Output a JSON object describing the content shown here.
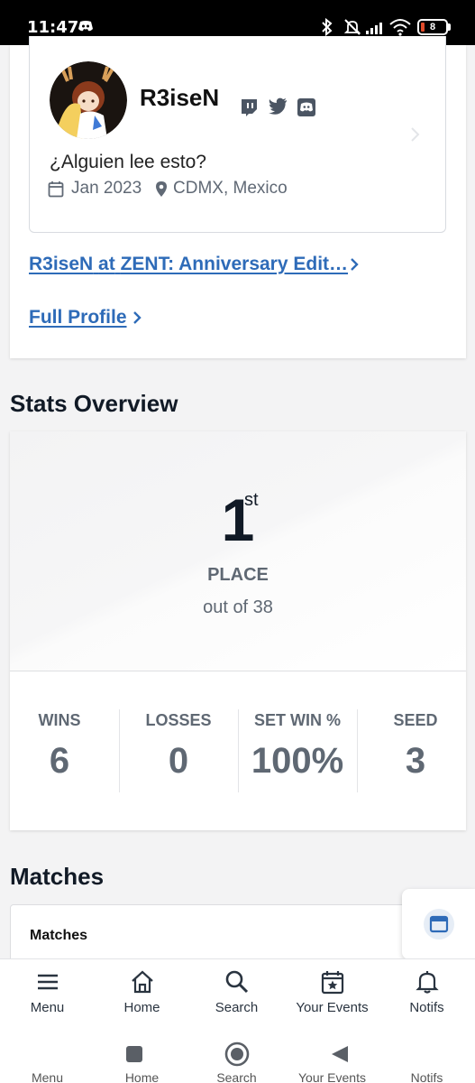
{
  "status_bar": {
    "time": "11:47",
    "battery": "8",
    "icons": [
      "discord-icon",
      "bluetooth-icon",
      "mute-icon",
      "signal-icon",
      "wifi-icon",
      "battery-icon"
    ]
  },
  "profile": {
    "username": "R3iseN",
    "bio": "¿Alguien lee esto?",
    "joined": "Jan 2023",
    "location": "CDMX, Mexico",
    "social_icons": [
      "twitch-icon",
      "twitter-icon",
      "discord-icon"
    ]
  },
  "links": {
    "event_player": "R3iseN",
    "event_at": "at",
    "event_name": "ZENT: Anniversary Edit…",
    "full_profile": "Full Profile"
  },
  "stats": {
    "title": "Stats Overview",
    "place_number": "1",
    "place_suffix": "st",
    "place_label": "PLACE",
    "place_out_of": "out of 38",
    "columns": [
      {
        "label": "WINS",
        "value": "6"
      },
      {
        "label": "LOSSES",
        "value": "0"
      },
      {
        "label": "SET WIN %",
        "value": "100%"
      },
      {
        "label": "SEED",
        "value": "3"
      }
    ]
  },
  "matches": {
    "title": "Matches",
    "card_header": "Matches"
  },
  "bottom_nav": [
    {
      "label": "Menu",
      "icon": "menu-icon"
    },
    {
      "label": "Home",
      "icon": "home-icon"
    },
    {
      "label": "Search",
      "icon": "search-icon"
    },
    {
      "label": "Your Events",
      "icon": "calendar-star-icon"
    },
    {
      "label": "Notifs",
      "icon": "bell-icon"
    }
  ],
  "colors": {
    "link": "#2e6bb8",
    "text_dark": "#111a26",
    "text_muted": "#5f6873",
    "battery_low": "#e14b2a"
  }
}
